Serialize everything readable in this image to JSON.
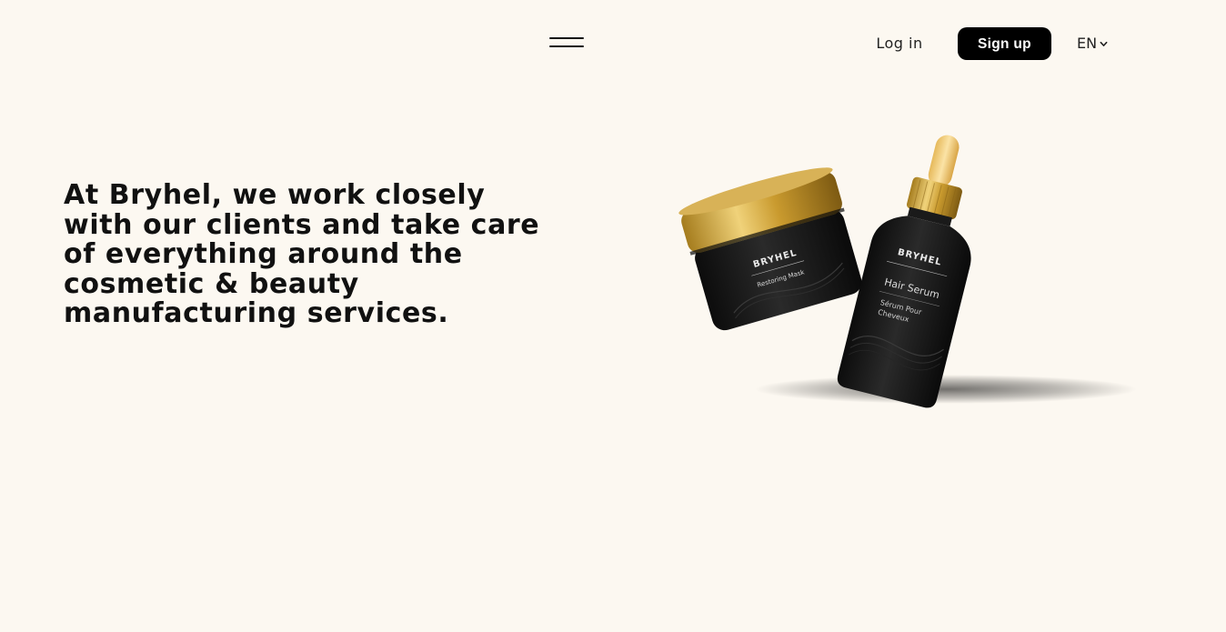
{
  "header": {
    "menu_icon": "hamburger-menu-icon",
    "login_label": "Log in",
    "signup_label": "Sign up",
    "language": "EN",
    "language_icon": "chevron-down-icon"
  },
  "hero": {
    "heading_lines": [
      "At Bryhel, we work closely",
      "with our clients and take care",
      "of everything around the",
      "cosmetic & beauty",
      "manufacturing services."
    ]
  },
  "products": {
    "jar": {
      "brand": "BRYHEL",
      "name": "Restoring Mask"
    },
    "bottle": {
      "brand": "BRYHEL",
      "name": "Hair Serum",
      "subtitle_line1": "Sérum Pour",
      "subtitle_line2": "Cheveux"
    }
  },
  "colors": {
    "background": "#fcf8f1",
    "text": "#111111",
    "button_bg": "#000000",
    "button_text": "#ffffff",
    "gold": "#c9a23a",
    "product_black": "#141414"
  }
}
